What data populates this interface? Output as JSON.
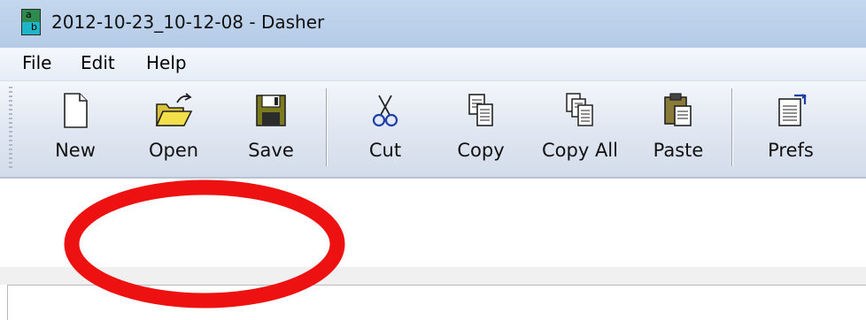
{
  "window": {
    "title": "2012-10-23_10-12-08 - Dasher",
    "icon_glyph_top": "a",
    "icon_glyph_bottom": "b",
    "icon": "dasher-app-icon"
  },
  "menu": {
    "items": [
      {
        "label": "File"
      },
      {
        "label": "Edit"
      },
      {
        "label": "Help"
      }
    ]
  },
  "toolbar": {
    "buttons": [
      {
        "label": "New",
        "icon": "new-document-icon"
      },
      {
        "label": "Open",
        "icon": "open-folder-icon"
      },
      {
        "label": "Save",
        "icon": "save-floppy-icon"
      },
      {
        "label": "Cut",
        "icon": "scissors-icon"
      },
      {
        "label": "Copy",
        "icon": "copy-icon"
      },
      {
        "label": "Copy All",
        "icon": "copy-all-icon"
      },
      {
        "label": "Paste",
        "icon": "paste-clipboard-icon"
      },
      {
        "label": "Prefs",
        "icon": "preferences-icon"
      }
    ]
  },
  "editor": {
    "text": ""
  },
  "annotation": {
    "shape": "ellipse",
    "color": "#ee1111"
  }
}
